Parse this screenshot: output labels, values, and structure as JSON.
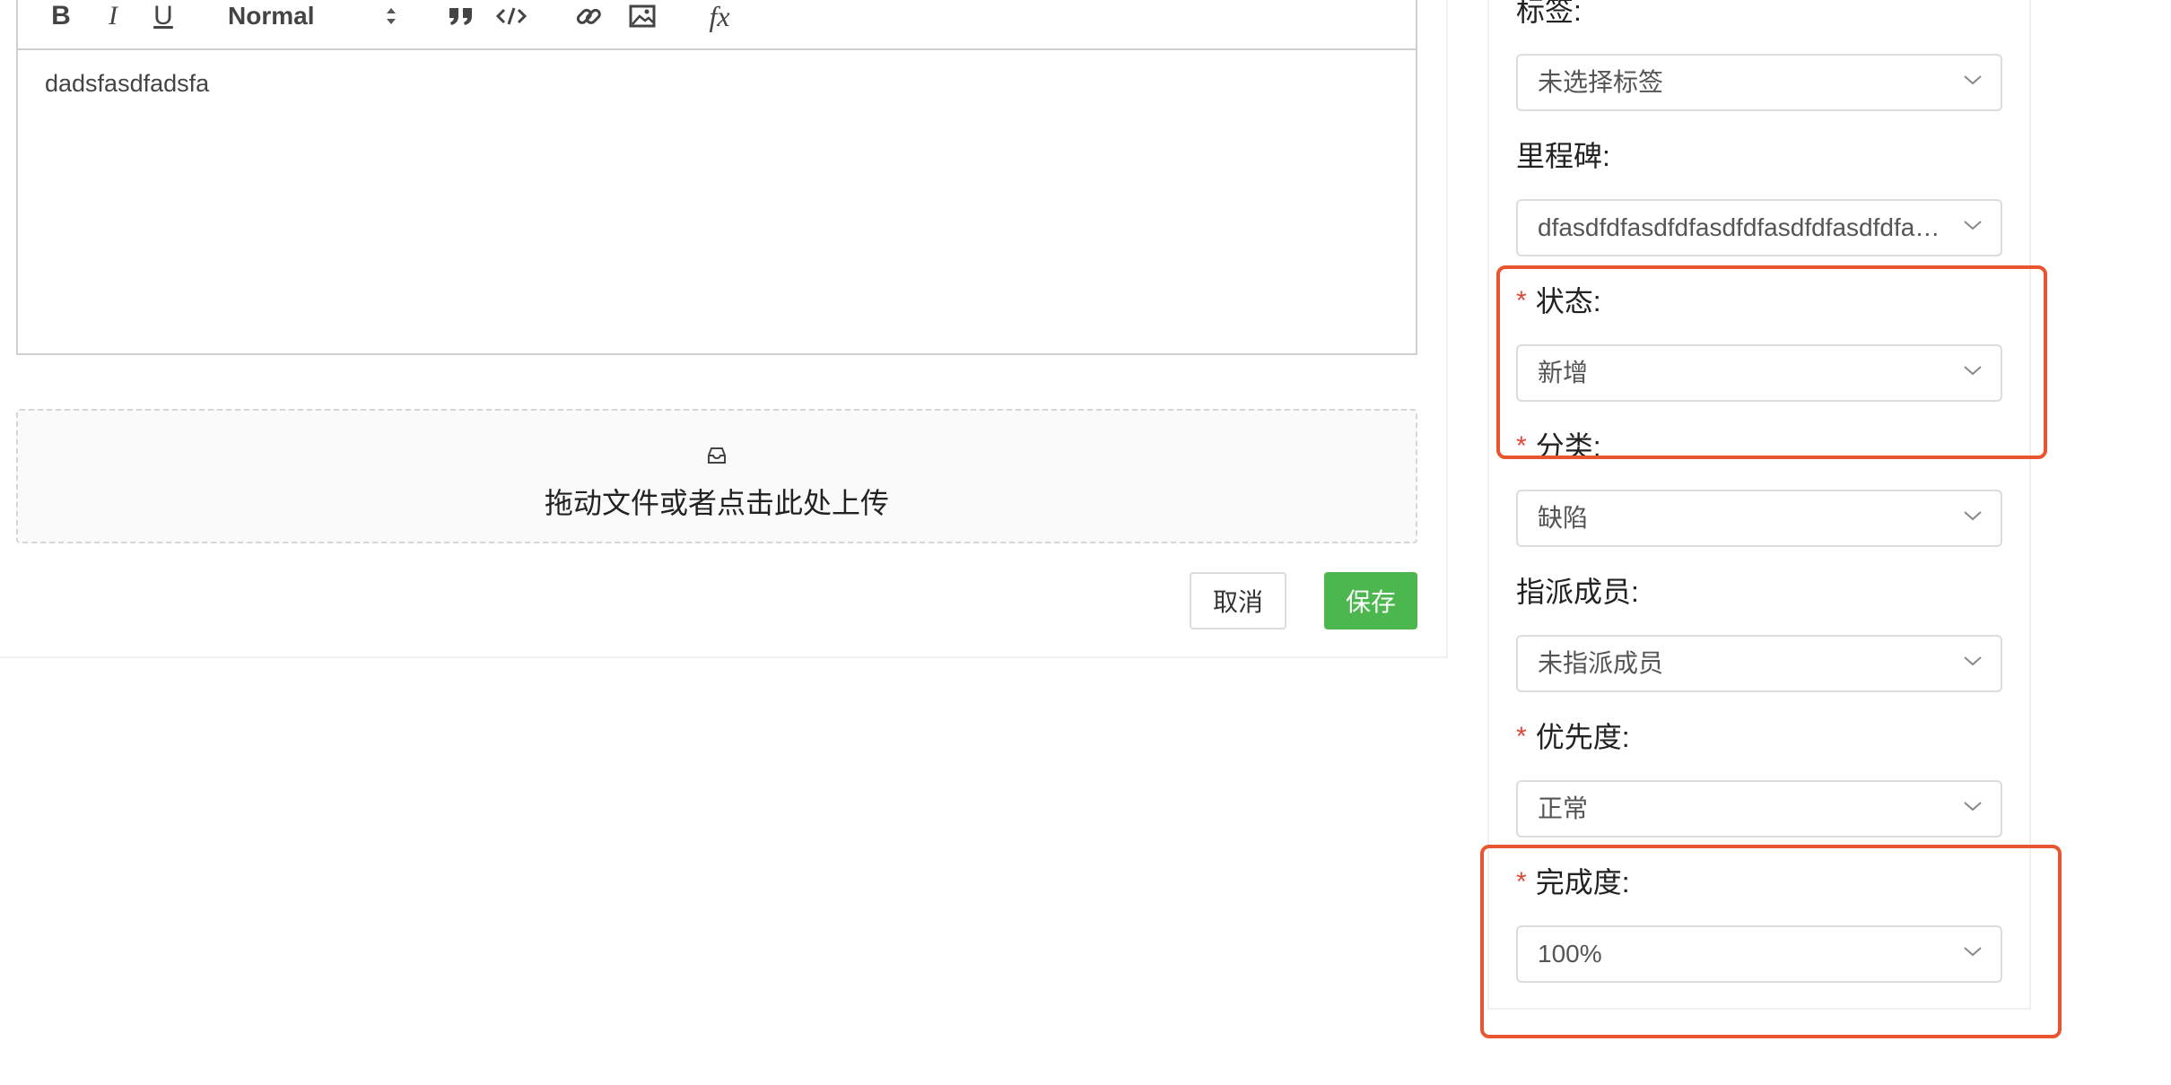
{
  "editor": {
    "toolbar": {
      "bold": "B",
      "italic": "I",
      "underline": "U",
      "heading_select": "Normal",
      "formula": "fx"
    },
    "content": "dadsfasdfadsfa"
  },
  "upload": {
    "text": "拖动文件或者点击此处上传"
  },
  "actions": {
    "cancel_label": "取消",
    "save_label": "保存"
  },
  "form": {
    "fields": [
      {
        "label": "标签:",
        "required": false,
        "value": "未选择标签"
      },
      {
        "label": "里程碑:",
        "required": false,
        "value": "dfasdfdfasdfdfasdfdfasdfdfasdfdfasdfdfasdf"
      },
      {
        "label": "状态:",
        "required": true,
        "value": "新增"
      },
      {
        "label": "分类:",
        "required": true,
        "value": "缺陷"
      },
      {
        "label": "指派成员:",
        "required": false,
        "value": "未指派成员"
      },
      {
        "label": "优先度:",
        "required": true,
        "value": "正常"
      },
      {
        "label": "完成度:",
        "required": true,
        "value": "100%"
      }
    ],
    "required_mark": "*"
  },
  "colors": {
    "save_button": "#4cb74f",
    "required_mark": "#e0483a",
    "highlight_box": "#e8552f"
  }
}
